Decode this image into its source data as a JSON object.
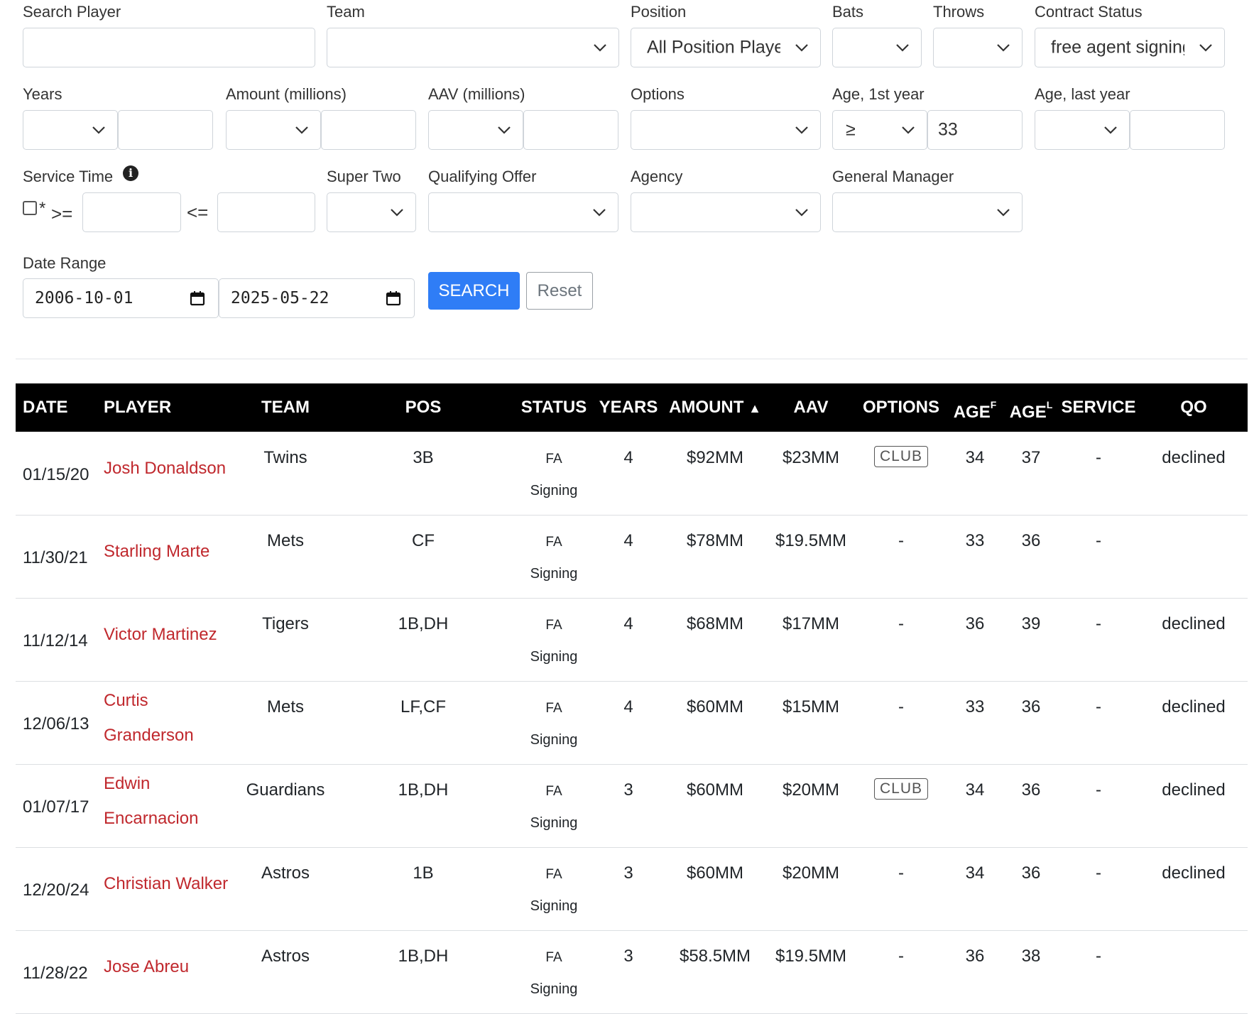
{
  "filters": {
    "search_player": {
      "label": "Search Player",
      "value": ""
    },
    "team": {
      "label": "Team",
      "value": ""
    },
    "position": {
      "label": "Position",
      "value": "All Position Playe"
    },
    "bats": {
      "label": "Bats",
      "value": ""
    },
    "throws": {
      "label": "Throws",
      "value": ""
    },
    "contract_status": {
      "label": "Contract Status",
      "value": "free agent signing"
    },
    "years": {
      "label": "Years"
    },
    "amount": {
      "label": "Amount (millions)"
    },
    "aav": {
      "label": "AAV (millions)"
    },
    "options": {
      "label": "Options"
    },
    "age_first": {
      "label": "Age, 1st year",
      "operator": "≥",
      "value": "33"
    },
    "age_last": {
      "label": "Age, last year"
    },
    "service_time": {
      "label": "Service Time",
      "star": "*",
      "gte": ">=",
      "lte": "<="
    },
    "super_two": {
      "label": "Super Two"
    },
    "qualifying_offer": {
      "label": "Qualifying Offer"
    },
    "agency": {
      "label": "Agency"
    },
    "general_manager": {
      "label": "General Manager"
    },
    "date_range": {
      "label": "Date Range",
      "from": "2006-10-01",
      "to": "2025-05-22"
    },
    "search_button": "SEARCH",
    "reset_button": "Reset"
  },
  "table": {
    "headers": {
      "date": "DATE",
      "player": "PLAYER",
      "team": "TEAM",
      "pos": "POS",
      "status": "STATUS",
      "years": "YEARS",
      "amount": "AMOUNT",
      "amount_sort": "▲",
      "aav": "AAV",
      "options": "OPTIONS",
      "age": "AGE",
      "age_f_sup": "F",
      "age_l_sup": "L",
      "service": "SERVICE",
      "qo": "QO"
    },
    "rows": [
      {
        "date": "01/15/20",
        "player_lines": [
          "Josh Donaldson"
        ],
        "team": "Twins",
        "pos": "3B",
        "status_1": "FA",
        "status_2": "Signing",
        "years": "4",
        "amount": "$92MM",
        "aav": "$23MM",
        "options": "CLUB",
        "age_f": "34",
        "age_l": "37",
        "service": "-",
        "qo": "declined"
      },
      {
        "date": "11/30/21",
        "player_lines": [
          "Starling Marte"
        ],
        "team": "Mets",
        "pos": "CF",
        "status_1": "FA",
        "status_2": "Signing",
        "years": "4",
        "amount": "$78MM",
        "aav": "$19.5MM",
        "options": "-",
        "age_f": "33",
        "age_l": "36",
        "service": "-",
        "qo": ""
      },
      {
        "date": "11/12/14",
        "player_lines": [
          "Victor Martinez"
        ],
        "team": "Tigers",
        "pos": "1B,DH",
        "status_1": "FA",
        "status_2": "Signing",
        "years": "4",
        "amount": "$68MM",
        "aav": "$17MM",
        "options": "-",
        "age_f": "36",
        "age_l": "39",
        "service": "-",
        "qo": "declined"
      },
      {
        "date": "12/06/13",
        "player_lines": [
          "Curtis",
          "Granderson"
        ],
        "team": "Mets",
        "pos": "LF,CF",
        "status_1": "FA",
        "status_2": "Signing",
        "years": "4",
        "amount": "$60MM",
        "aav": "$15MM",
        "options": "-",
        "age_f": "33",
        "age_l": "36",
        "service": "-",
        "qo": "declined"
      },
      {
        "date": "01/07/17",
        "player_lines": [
          "Edwin",
          "Encarnacion"
        ],
        "team": "Guardians",
        "pos": "1B,DH",
        "status_1": "FA",
        "status_2": "Signing",
        "years": "3",
        "amount": "$60MM",
        "aav": "$20MM",
        "options": "CLUB",
        "age_f": "34",
        "age_l": "36",
        "service": "-",
        "qo": "declined"
      },
      {
        "date": "12/20/24",
        "player_lines": [
          "Christian Walker"
        ],
        "team": "Astros",
        "pos": "1B",
        "status_1": "FA",
        "status_2": "Signing",
        "years": "3",
        "amount": "$60MM",
        "aav": "$20MM",
        "options": "-",
        "age_f": "34",
        "age_l": "36",
        "service": "-",
        "qo": "declined"
      },
      {
        "date": "11/28/22",
        "player_lines": [
          "Jose Abreu"
        ],
        "team": "Astros",
        "pos": "1B,DH",
        "status_1": "FA",
        "status_2": "Signing",
        "years": "3",
        "amount": "$58.5MM",
        "aav": "$19.5MM",
        "options": "-",
        "age_f": "36",
        "age_l": "38",
        "service": "-",
        "qo": ""
      }
    ]
  }
}
